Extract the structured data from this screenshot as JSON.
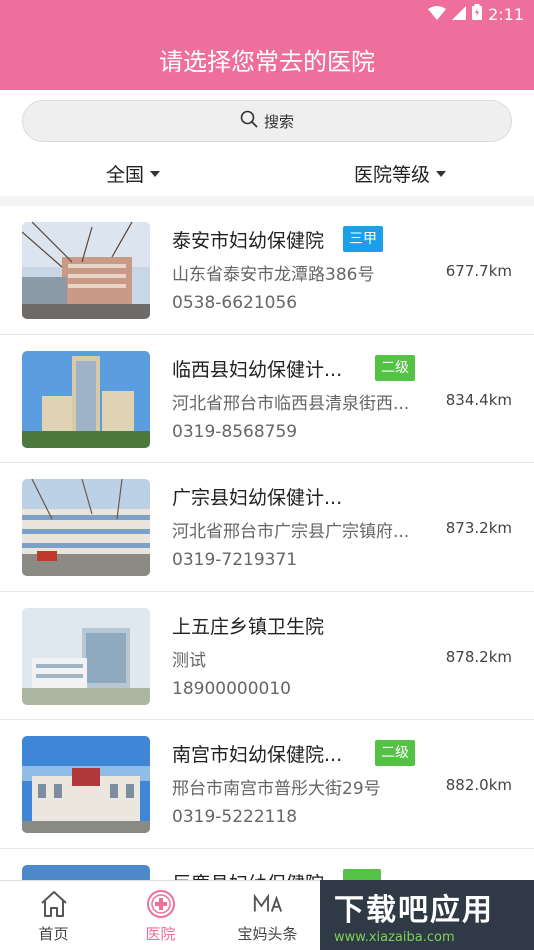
{
  "status": {
    "time": "2:11"
  },
  "header": {
    "title": "请选择您常去的医院"
  },
  "search": {
    "label": "搜索"
  },
  "filters": {
    "region": "全国",
    "level": "医院等级"
  },
  "hospitals": [
    {
      "name": "泰安市妇幼保健院",
      "badge": "三甲",
      "address": "山东省泰安市龙潭路386号",
      "phone": "0538-6621056",
      "distance": "677.7km"
    },
    {
      "name": "临西县妇幼保健计...",
      "badge": "二级",
      "address": "河北省邢台市临西县清泉街西...",
      "phone": "0319-8568759",
      "distance": "834.4km"
    },
    {
      "name": "广宗县妇幼保健计...",
      "address": "河北省邢台市广宗县广宗镇府...",
      "phone": "0319-7219371",
      "distance": "873.2km"
    },
    {
      "name": "上五庄乡镇卫生院",
      "address": "测试",
      "phone": "18900000010",
      "distance": "878.2km"
    },
    {
      "name": "南宫市妇幼保健院...",
      "badge": "二级",
      "address": "邢台市南宫市普彤大街29号",
      "phone": "0319-5222118",
      "distance": "882.0km"
    },
    {
      "name": "巨鹿县妇幼保健院"
    }
  ],
  "tabs": {
    "home": "首页",
    "hospital": "医院",
    "news": "宝妈头条"
  },
  "watermark": {
    "title": "下载吧应用",
    "url": "www.xiazaiba.com"
  }
}
